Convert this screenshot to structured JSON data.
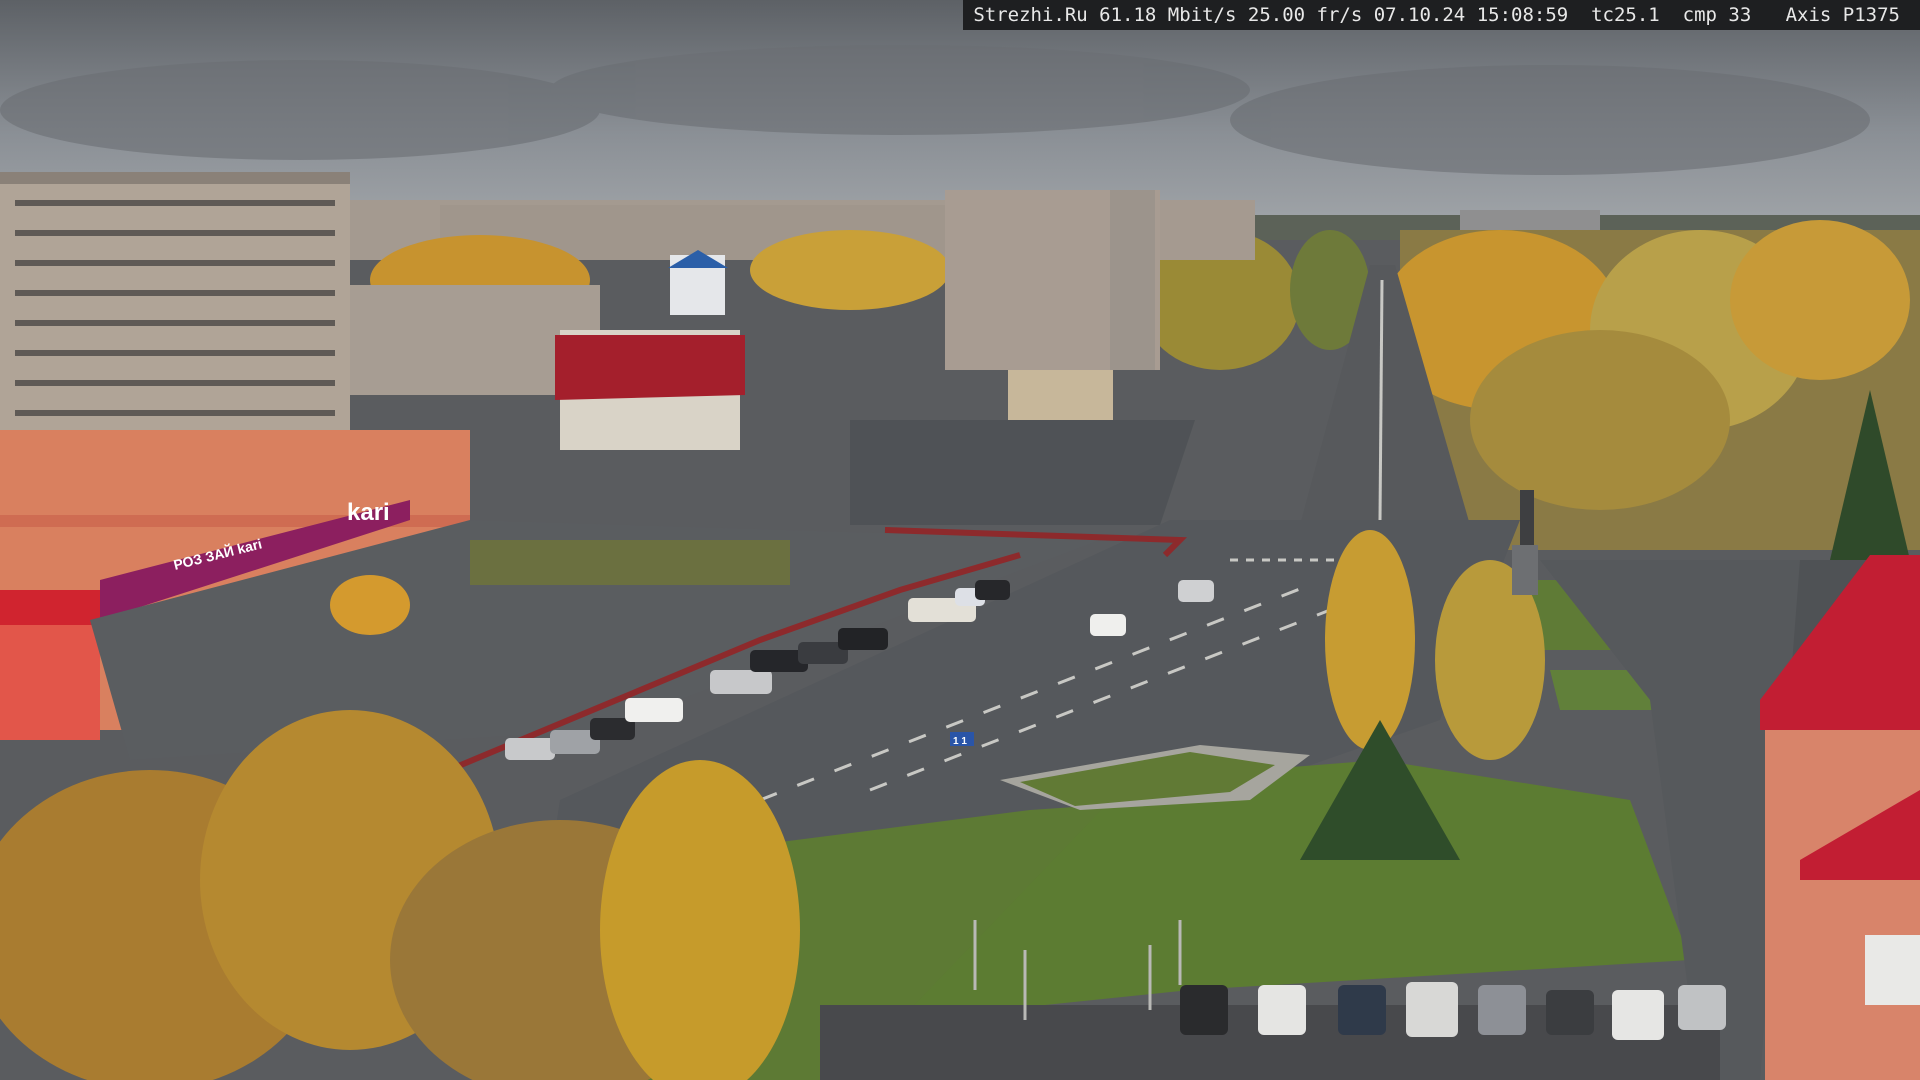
{
  "osd": {
    "site": "Strezhi.Ru",
    "bitrate": "61.18 Mbit/s",
    "framerate": "25.00 fr/s",
    "date": "07.10.24",
    "time": "15:08:59",
    "tc": "tc25.1",
    "cmp": "cmp 33",
    "camera": "Axis P1375"
  },
  "store": {
    "brand": "kari",
    "brand_long": "РОЗ ЗАЙ kari"
  },
  "signs": {
    "lane_sign": "1 1"
  },
  "colors": {
    "sky": "#7d8288",
    "road": "#55585c",
    "grass": "#5d7a34",
    "foliage_yellow": "#c89a2a",
    "store_purple": "#8c1f5f",
    "roof_red": "#b51f33"
  }
}
